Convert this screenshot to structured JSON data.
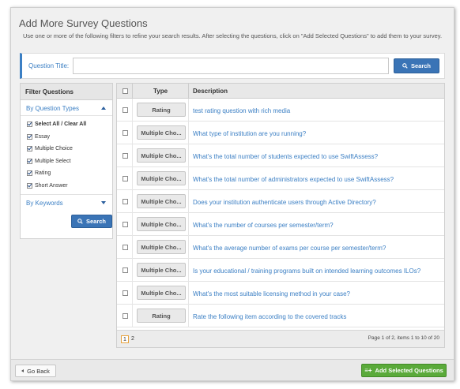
{
  "dialog": {
    "title": "Add More Survey Questions",
    "subtitle": "Use one or more of the following filters to refine your search results. After selecting the questions, click on \"Add Selected Questions\" to add them to your survey."
  },
  "search": {
    "label": "Question Title:",
    "value": "",
    "placeholder": "",
    "button_label": "Search"
  },
  "filter": {
    "heading": "Filter Questions",
    "by_question_types": "By Question Types",
    "options": [
      {
        "label": "Select All / Clear All",
        "checked": true
      },
      {
        "label": "Essay",
        "checked": true
      },
      {
        "label": "Multiple Choice",
        "checked": true
      },
      {
        "label": "Multiple Select",
        "checked": true
      },
      {
        "label": "Rating",
        "checked": true
      },
      {
        "label": "Short Answer",
        "checked": true
      }
    ],
    "by_keywords": "By Keywords",
    "search_button_label": "Search"
  },
  "grid": {
    "columns": {
      "type": "Type",
      "description": "Description"
    },
    "rows": [
      {
        "type": "Rating",
        "description": "test rating question with rich media"
      },
      {
        "type": "Multiple Cho...",
        "description": "What type of institution are you running?"
      },
      {
        "type": "Multiple Cho...",
        "description": "What's the total number of students expected to use SwiftAssess?"
      },
      {
        "type": "Multiple Cho...",
        "description": "What's the total number of administrators expected to use SwiftAssess?"
      },
      {
        "type": "Multiple Cho...",
        "description": "Does your institution authenticate users through Active Directory?"
      },
      {
        "type": "Multiple Cho...",
        "description": "What's the number of courses per semester/term?"
      },
      {
        "type": "Multiple Cho...",
        "description": "What's the average number of exams per course per semester/term?"
      },
      {
        "type": "Multiple Cho...",
        "description": "Is your educational / training programs built on intended learning outcomes ILOs?"
      },
      {
        "type": "Multiple Cho...",
        "description": "What's the most suitable licensing method in your case?"
      },
      {
        "type": "Rating",
        "description": "Rate the following item according to the covered tracks"
      }
    ],
    "pager": {
      "pages": [
        "1",
        "2"
      ],
      "current": "1",
      "info": "Page 1 of 2, items 1 to 10 of 20"
    }
  },
  "footer": {
    "go_back_label": "Go Back",
    "add_selected_label": "Add Selected Questions"
  },
  "colors": {
    "accent": "#3b7fc4",
    "primary_button": "#3a74b6",
    "success_button": "#5aaa3a"
  }
}
